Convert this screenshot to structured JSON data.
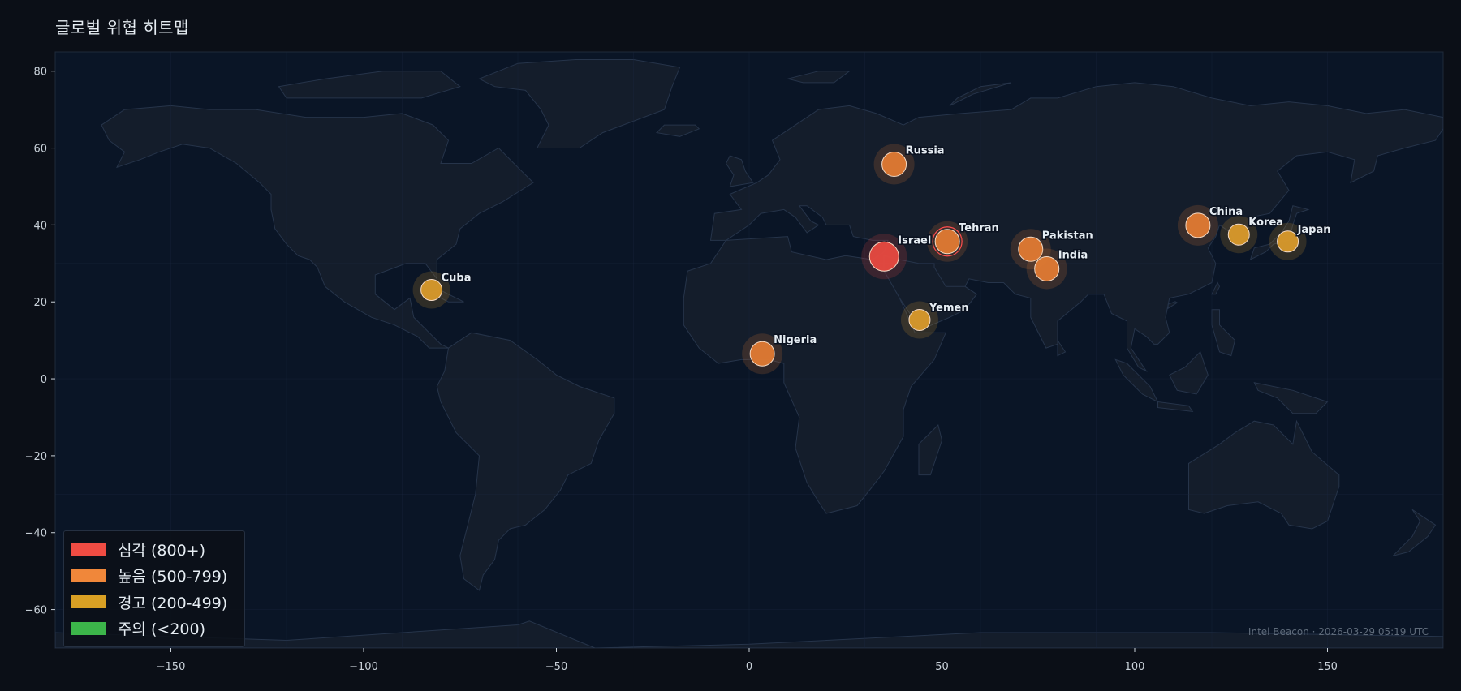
{
  "title": "글로벌 위협 히트맵",
  "watermark": "Intel Beacon · 2026-03-29 05:19 UTC",
  "chart_data": {
    "type": "scatter",
    "title": "글로벌 위협 히트맵",
    "xlim": [
      -180,
      180
    ],
    "ylim": [
      -70,
      85
    ],
    "x_ticks": [
      -150,
      -100,
      -50,
      0,
      50,
      100,
      150
    ],
    "y_ticks": [
      80,
      60,
      40,
      20,
      0,
      -20,
      -40,
      -60
    ],
    "grid": true,
    "legend_position": "bottom-left",
    "points": [
      {
        "label": "Russia",
        "x": 37.6,
        "y": 55.8,
        "level": "high"
      },
      {
        "label": "Tehran",
        "x": 51.4,
        "y": 35.7,
        "level": "high"
      },
      {
        "label": "Israel",
        "x": 35.0,
        "y": 31.8,
        "level": "critical"
      },
      {
        "label": "Pakistan",
        "x": 73.0,
        "y": 33.7,
        "level": "high"
      },
      {
        "label": "India",
        "x": 77.2,
        "y": 28.6,
        "level": "high"
      },
      {
        "label": "China",
        "x": 116.4,
        "y": 39.9,
        "level": "high"
      },
      {
        "label": "Korea",
        "x": 127.0,
        "y": 37.5,
        "level": "warning"
      },
      {
        "label": "Japan",
        "x": 139.7,
        "y": 35.7,
        "level": "warning"
      },
      {
        "label": "Yemen",
        "x": 44.2,
        "y": 15.3,
        "level": "warning"
      },
      {
        "label": "Nigeria",
        "x": 3.4,
        "y": 6.5,
        "level": "high"
      },
      {
        "label": "Cuba",
        "x": -82.4,
        "y": 23.1,
        "level": "warning"
      }
    ]
  },
  "legend": {
    "items": [
      {
        "label": "심각 (800+)",
        "color": "#f04c43"
      },
      {
        "label": "높음 (500-799)",
        "color": "#f0873a"
      },
      {
        "label": "경고 (200-499)",
        "color": "#d9a024"
      },
      {
        "label": "주의 (<200)",
        "color": "#3cb54a"
      }
    ]
  },
  "colors": {
    "background": "#0b0f17",
    "ocean": "#0a1526",
    "land": "#141d2b",
    "land_border": "#26344a",
    "critical": "#e84a40",
    "high": "#e07a33",
    "warning": "#d99a2b"
  }
}
